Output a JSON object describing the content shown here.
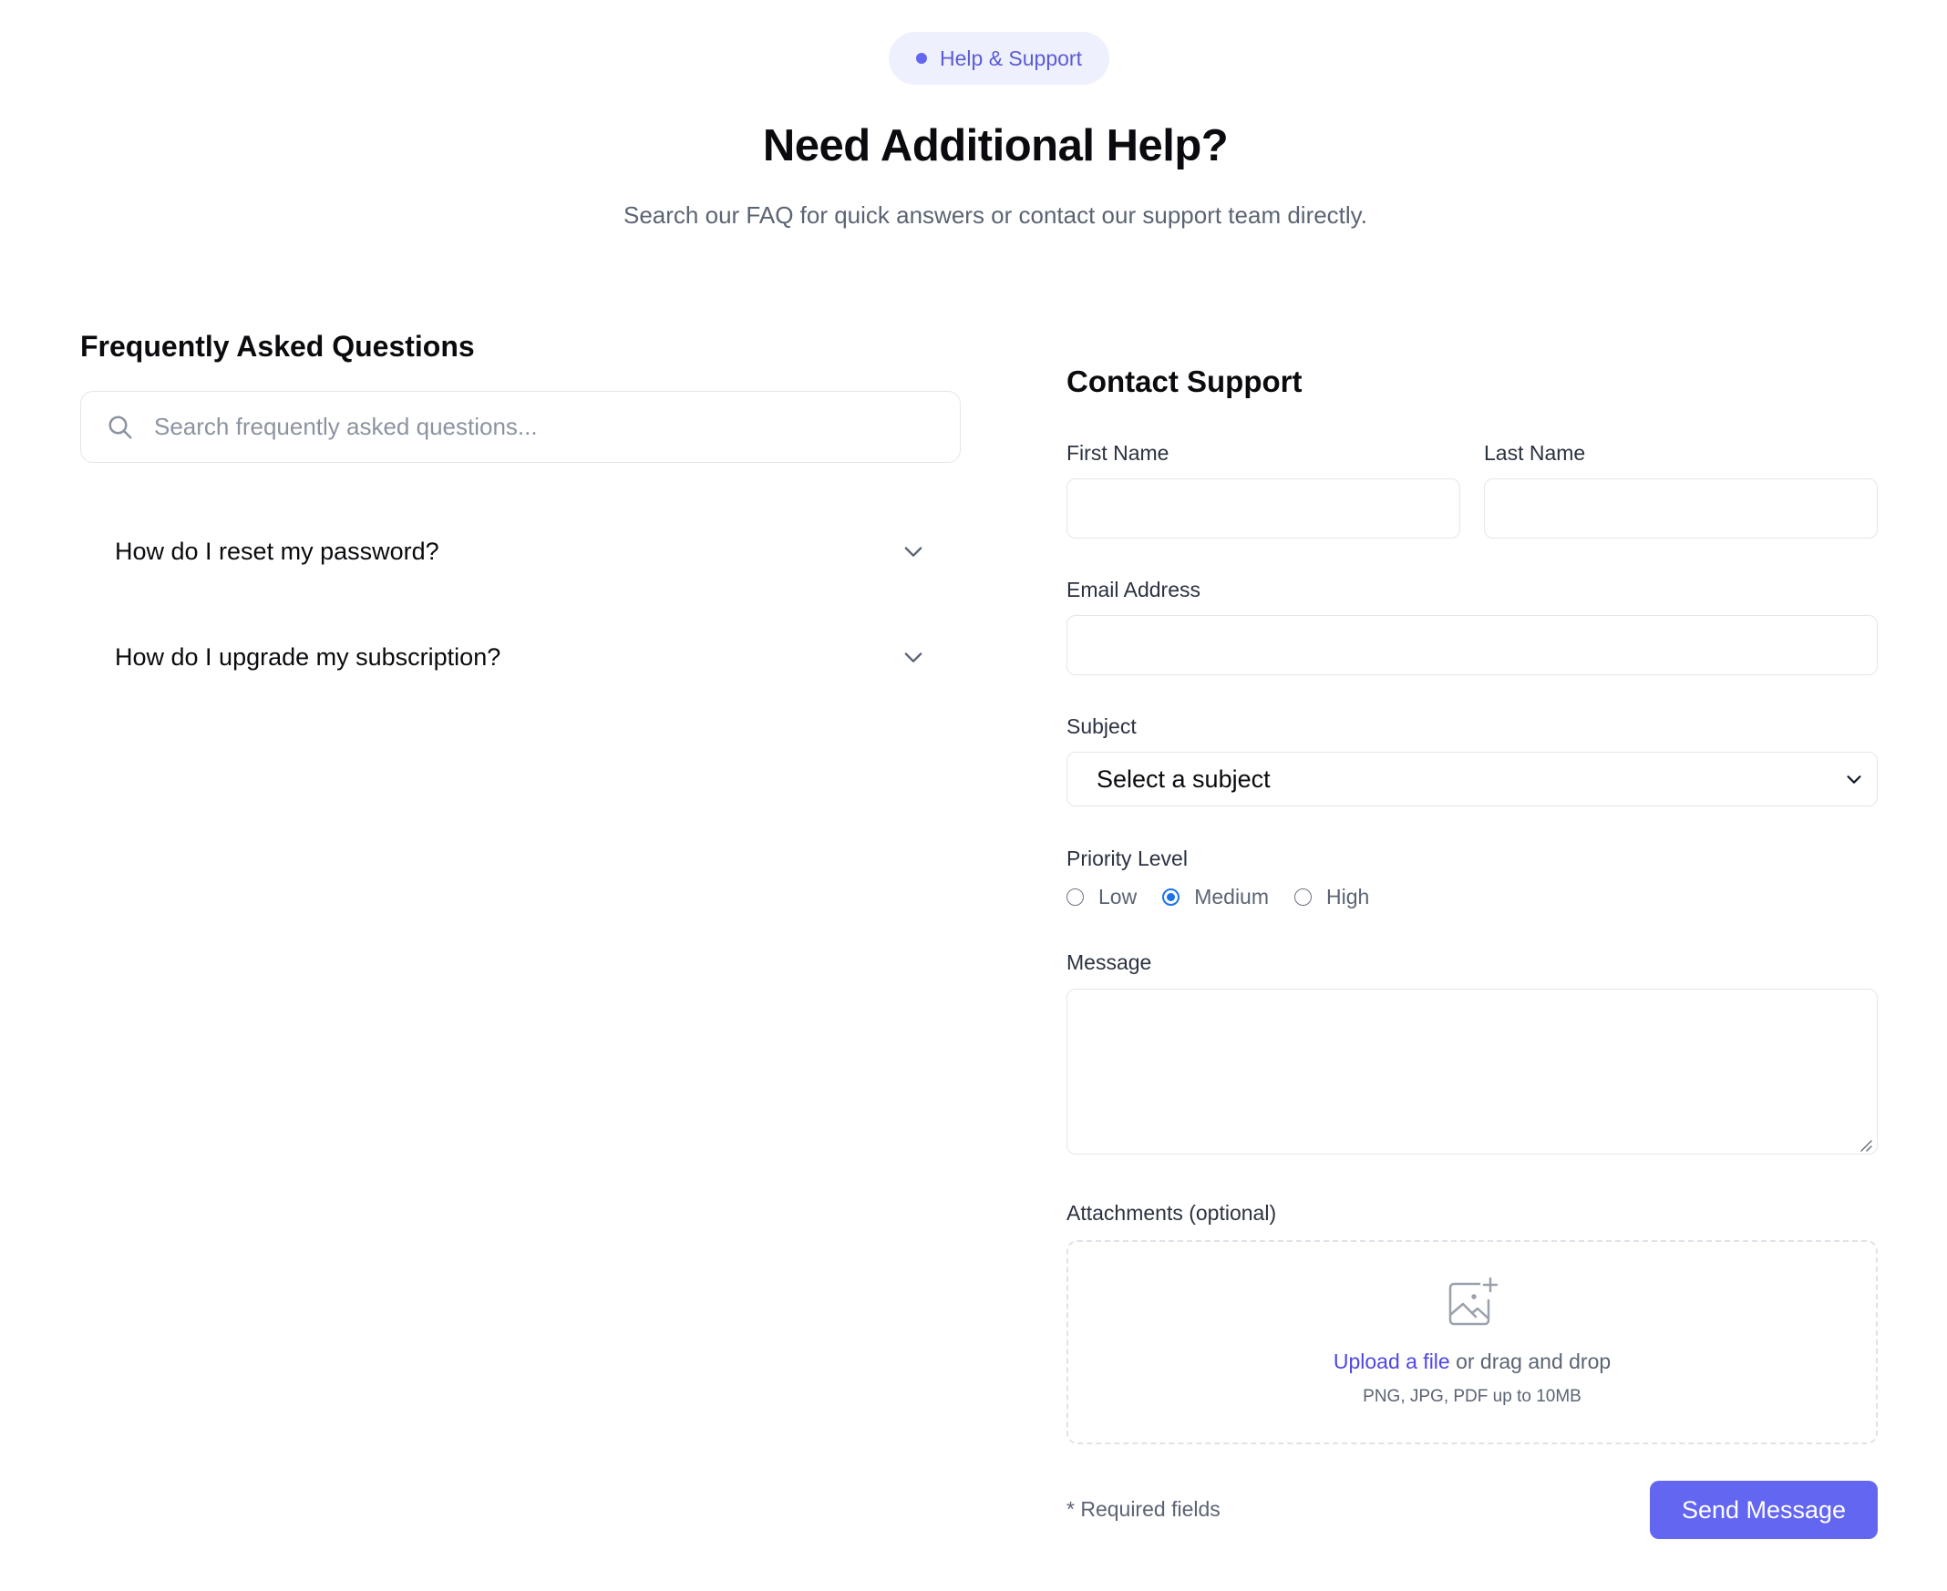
{
  "header": {
    "badge": "Help & Support",
    "title": "Need Additional Help?",
    "subtitle": "Search our FAQ for quick answers or contact our support team directly."
  },
  "faq": {
    "heading": "Frequently Asked Questions",
    "search_placeholder": "Search frequently asked questions...",
    "items": [
      {
        "question": "How do I reset my password?"
      },
      {
        "question": "How do I upgrade my subscription?"
      }
    ]
  },
  "contact": {
    "heading": "Contact Support",
    "first_name_label": "First Name",
    "last_name_label": "Last Name",
    "email_label": "Email Address",
    "subject_label": "Subject",
    "subject_selected": "Select a subject",
    "priority_label": "Priority Level",
    "priority_options": [
      "Low",
      "Medium",
      "High"
    ],
    "priority_selected": "Medium",
    "message_label": "Message",
    "attachments_label": "Attachments (optional)",
    "upload_link": "Upload a file",
    "upload_text": " or drag and drop",
    "upload_hint": "PNG, JPG, PDF up to 10MB",
    "required_note": "* Required fields",
    "send_label": "Send Message"
  },
  "colors": {
    "accent": "#6366f1",
    "badge_bg": "#eef0fd",
    "link": "#4f46e5",
    "radio_selected": "#1a73e8"
  }
}
